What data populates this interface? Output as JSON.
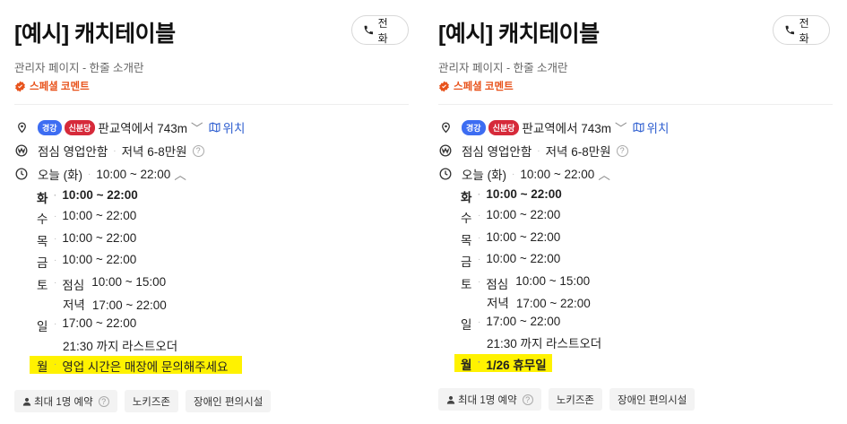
{
  "panels": [
    {
      "title": "[예시] 캐치테이블",
      "call_label": "전화",
      "subtitle": "관리자 페이지 - 한줄 소개란",
      "special_comment": "스페셜 코멘트",
      "location": {
        "tag1": "경강",
        "tag2": "신분당",
        "text": "판교역에서 743m",
        "link": "위치"
      },
      "meal": {
        "text": "점심 영업안함",
        "price": "저녁 6-8만원"
      },
      "hours_today": {
        "day": "오늘 (화)",
        "time": "10:00 ~ 22:00"
      },
      "days": {
        "tue": {
          "d": "화",
          "time": "10:00 ~ 22:00"
        },
        "wed": {
          "d": "수",
          "time": "10:00 ~ 22:00"
        },
        "thu": {
          "d": "목",
          "time": "10:00 ~ 22:00"
        },
        "fri": {
          "d": "금",
          "time": "10:00 ~ 22:00"
        },
        "sat": {
          "d": "토",
          "lunch_label": "점심",
          "lunch": "10:00 ~ 15:00",
          "dinner_label": "저녁",
          "dinner": "17:00 ~ 22:00"
        },
        "sun": {
          "d": "일",
          "time": "17:00 ~ 22:00",
          "note": "21:30 까지 라스트오더"
        },
        "mon": {
          "d": "월",
          "note": "영업 시간은 매장에 문의해주세요"
        }
      },
      "chips": [
        "최대 1명 예약",
        "노키즈존",
        "장애인 편의시설"
      ]
    },
    {
      "title": "[예시] 캐치테이블",
      "call_label": "전화",
      "subtitle": "관리자 페이지 - 한줄 소개란",
      "special_comment": "스페셜 코멘트",
      "location": {
        "tag1": "경강",
        "tag2": "신분당",
        "text": "판교역에서 743m",
        "link": "위치"
      },
      "meal": {
        "text": "점심 영업안함",
        "price": "저녁 6-8만원"
      },
      "hours_today": {
        "day": "오늘 (화)",
        "time": "10:00 ~ 22:00"
      },
      "days": {
        "tue": {
          "d": "화",
          "time": "10:00 ~ 22:00"
        },
        "wed": {
          "d": "수",
          "time": "10:00 ~ 22:00"
        },
        "thu": {
          "d": "목",
          "time": "10:00 ~ 22:00"
        },
        "fri": {
          "d": "금",
          "time": "10:00 ~ 22:00"
        },
        "sat": {
          "d": "토",
          "lunch_label": "점심",
          "lunch": "10:00 ~ 15:00",
          "dinner_label": "저녁",
          "dinner": "17:00 ~ 22:00"
        },
        "sun": {
          "d": "일",
          "time": "17:00 ~ 22:00",
          "note": "21:30 까지 라스트오더"
        },
        "mon": {
          "d": "월",
          "note": "1/26 휴무일"
        }
      },
      "chips": [
        "최대 1명 예약",
        "노키즈존",
        "장애인 편의시설"
      ]
    }
  ],
  "colors": {
    "accent_orange": "#e8531c",
    "link_blue": "#2f5fd0",
    "highlight": "#fff200",
    "tag_blue": "#3d6df2",
    "tag_red": "#d62a3a"
  },
  "icons": [
    "phone-icon",
    "verified-badge-icon",
    "location-pin-icon",
    "won-icon",
    "clock-icon",
    "map-icon",
    "chevron-down-icon",
    "chevron-up-icon",
    "help-icon",
    "person-icon"
  ]
}
